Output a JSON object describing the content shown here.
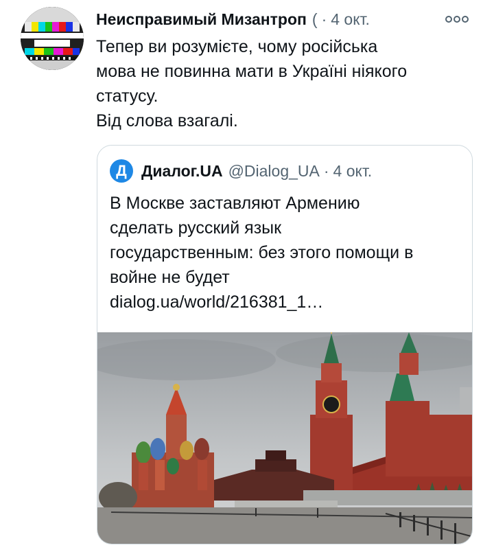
{
  "tweet": {
    "author_name": "Неисправимый Мизантроп",
    "handle": "(",
    "separator": "·",
    "date": "4 окт.",
    "avatar_icon": "tv-test-pattern-icon",
    "more_icon": "more-options-icon",
    "text_lines": [
      "Тепер ви розумієте, чому російська",
      "мова не повинна мати в Україні ніякого",
      "статусу.",
      "Від слова взагалі."
    ]
  },
  "quote": {
    "avatar_letter": "Д",
    "author_name": "Диалог.UA",
    "handle": "@Dialog_UA",
    "separator": "·",
    "date": "4 окт.",
    "text_lines": [
      "В Москве заставляют Армению",
      "сделать русский язык",
      "государственным: без этого помощи в",
      "войне не будет",
      "dialog.ua/world/216381_1…"
    ],
    "image_subject": "red-square-kremlin-photo"
  },
  "colors": {
    "text_primary": "#0f1419",
    "text_secondary": "#536471",
    "border": "#cfd9de",
    "dialog_blue": "#1e88e5"
  }
}
